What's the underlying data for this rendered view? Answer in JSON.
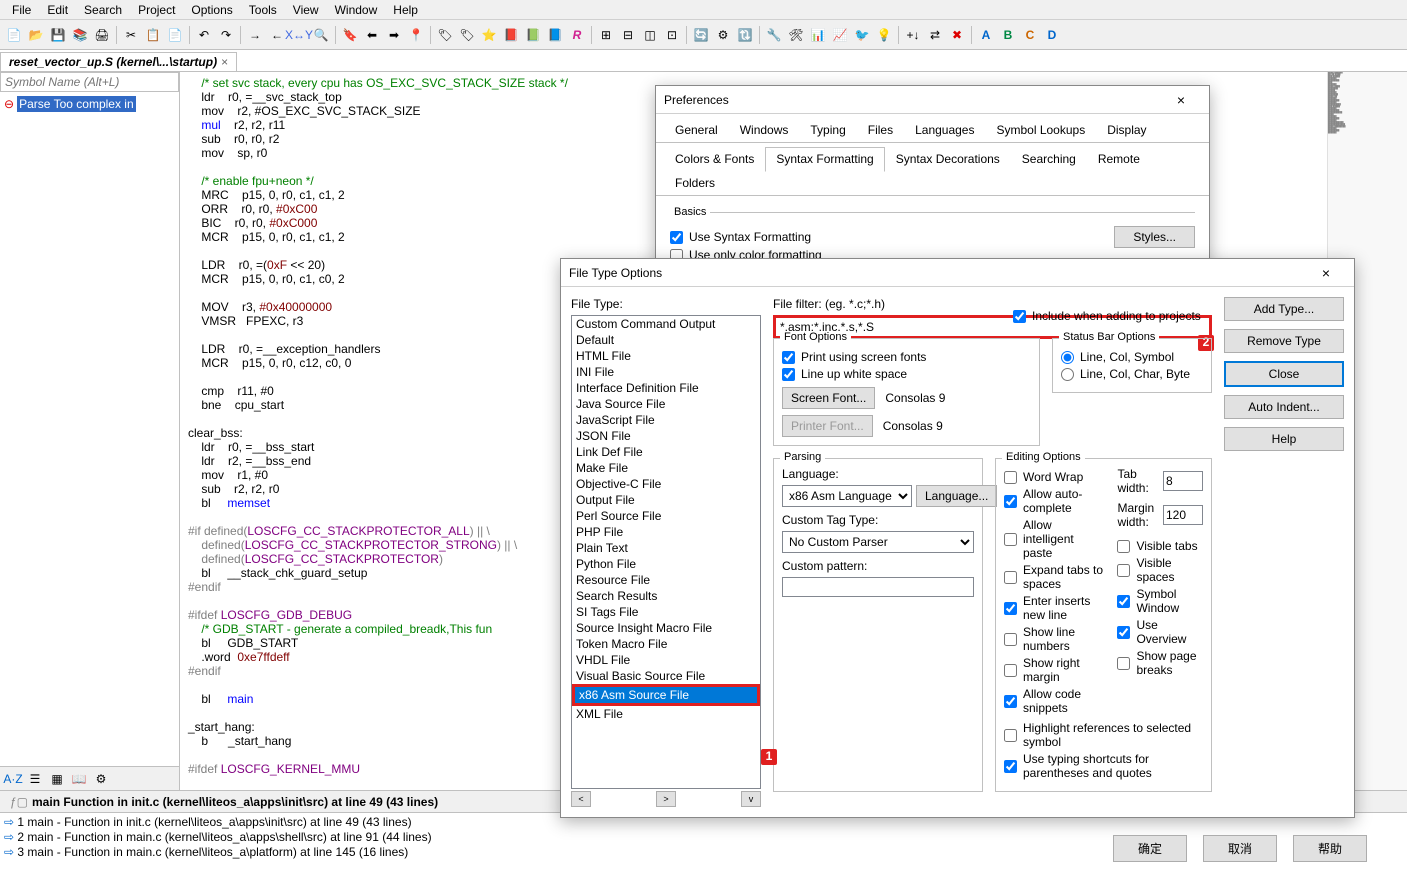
{
  "menu": [
    "File",
    "Edit",
    "Search",
    "Project",
    "Options",
    "Tools",
    "View",
    "Window",
    "Help"
  ],
  "openTab": {
    "label": "reset_vector_up.S (kernel\\...\\startup)"
  },
  "sidePanel": {
    "placeholder": "Symbol Name (Alt+L)",
    "parseErr": "Parse Too complex in"
  },
  "code": {
    "lines": [
      {
        "t": "cmt",
        "s": "    /* set svc stack, every cpu has OS_EXC_SVC_STACK_SIZE stack */"
      },
      {
        "t": "plain",
        "s": "    ldr    r0, =__svc_stack_top"
      },
      {
        "t": "plain",
        "s": "    mov    r2, #OS_EXC_SVC_STACK_SIZE"
      },
      {
        "t": "kw",
        "s": "    mul    r2, r2, r11"
      },
      {
        "t": "plain",
        "s": "    sub    r0, r0, r2"
      },
      {
        "t": "plain",
        "s": "    mov    sp, r0"
      },
      {
        "t": "plain",
        "s": ""
      },
      {
        "t": "cmt",
        "s": "    /* enable fpu+neon */"
      },
      {
        "t": "plain",
        "s": "    MRC    p15, 0, r0, c1, c1, 2"
      },
      {
        "t": "num",
        "s": "    ORR    r0, r0, #0xC00"
      },
      {
        "t": "num",
        "s": "    BIC    r0, r0, #0xC000"
      },
      {
        "t": "plain",
        "s": "    MCR    p15, 0, r0, c1, c1, 2"
      },
      {
        "t": "plain",
        "s": ""
      },
      {
        "t": "num",
        "s": "    LDR    r0, =(0xF << 20)"
      },
      {
        "t": "plain",
        "s": "    MCR    p15, 0, r0, c1, c0, 2"
      },
      {
        "t": "plain",
        "s": ""
      },
      {
        "t": "num",
        "s": "    MOV    r3, #0x40000000"
      },
      {
        "t": "plain",
        "s": "    VMSR   FPEXC, r3"
      },
      {
        "t": "plain",
        "s": ""
      },
      {
        "t": "plain",
        "s": "    LDR    r0, =__exception_handlers"
      },
      {
        "t": "plain",
        "s": "    MCR    p15, 0, r0, c12, c0, 0"
      },
      {
        "t": "plain",
        "s": ""
      },
      {
        "t": "plain",
        "s": "    cmp    r11, #0"
      },
      {
        "t": "plain",
        "s": "    bne    cpu_start"
      },
      {
        "t": "plain",
        "s": ""
      },
      {
        "t": "plain",
        "s": "clear_bss:"
      },
      {
        "t": "plain",
        "s": "    ldr    r0, =__bss_start"
      },
      {
        "t": "plain",
        "s": "    ldr    r2, =__bss_end"
      },
      {
        "t": "plain",
        "s": "    mov    r1, #0"
      },
      {
        "t": "plain",
        "s": "    sub    r2, r2, r0"
      },
      {
        "t": "kw",
        "s": "    bl     memset"
      },
      {
        "t": "plain",
        "s": ""
      },
      {
        "t": "dir",
        "s": "#if defined(LOSCFG_CC_STACKPROTECTOR_ALL) || \\"
      },
      {
        "t": "dir",
        "s": "    defined(LOSCFG_CC_STACKPROTECTOR_STRONG) || \\"
      },
      {
        "t": "dir",
        "s": "    defined(LOSCFG_CC_STACKPROTECTOR)"
      },
      {
        "t": "plain",
        "s": "    bl     __stack_chk_guard_setup"
      },
      {
        "t": "dir",
        "s": "#endif"
      },
      {
        "t": "plain",
        "s": ""
      },
      {
        "t": "dir",
        "s": "#ifdef LOSCFG_GDB_DEBUG"
      },
      {
        "t": "cmt",
        "s": "    /* GDB_START - generate a compiled_breadk,This fun"
      },
      {
        "t": "plain",
        "s": "    bl     GDB_START"
      },
      {
        "t": "num",
        "s": "    .word  0xe7ffdeff"
      },
      {
        "t": "dir",
        "s": "#endif"
      },
      {
        "t": "plain",
        "s": ""
      },
      {
        "t": "kw",
        "s": "    bl     main"
      },
      {
        "t": "plain",
        "s": ""
      },
      {
        "t": "plain",
        "s": "_start_hang:"
      },
      {
        "t": "plain",
        "s": "    b      _start_hang"
      },
      {
        "t": "plain",
        "s": ""
      },
      {
        "t": "dir",
        "s": "#ifdef LOSCFG_KERNEL_MMU"
      }
    ]
  },
  "bottomPane": {
    "header": "main Function in init.c (kernel\\liteos_a\\apps\\init\\src) at line 49 (43 lines)",
    "items": [
      "1 main - Function in init.c (kernel\\liteos_a\\apps\\init\\src) at line 49 (43 lines)",
      "2 main - Function in main.c (kernel\\liteos_a\\apps\\shell\\src) at line 91 (44 lines)",
      "3 main - Function in main.c (kernel\\liteos_a\\platform) at line 145 (16 lines)"
    ]
  },
  "prefs": {
    "title": "Preferences",
    "tabs1": [
      "General",
      "Windows",
      "Typing",
      "Files",
      "Languages",
      "Symbol Lookups",
      "Display"
    ],
    "tabs2": [
      "Colors & Fonts",
      "Syntax Formatting",
      "Syntax Decorations",
      "Searching",
      "Remote",
      "Folders"
    ],
    "activeTab": "Syntax Formatting",
    "basicsLabel": "Basics",
    "c1": "Use Syntax Formatting",
    "c2": "Use only color formatting",
    "stylesBtn": "Styles..."
  },
  "fto": {
    "title": "File Type Options",
    "fileTypeLabel": "File Type:",
    "fileFilterLabel": "File filter: (eg. *.c;*.h)",
    "fileFilterValue": "*.asm;*.inc,*.s,*.S",
    "types": [
      "Custom Command Output",
      "Default",
      "HTML File",
      "INI File",
      "Interface Definition File",
      "Java Source File",
      "JavaScript File",
      "JSON File",
      "Link Def File",
      "Make File",
      "Objective-C File",
      "Output File",
      "Perl Source File",
      "PHP File",
      "Plain Text",
      "Python File",
      "Resource File",
      "Search Results",
      "SI Tags File",
      "Source Insight Macro File",
      "Token Macro File",
      "VHDL File",
      "Visual Basic Source File",
      "x86 Asm Source File",
      "XML File"
    ],
    "selectedType": "x86 Asm Source File",
    "addTypeBtn": "Add Type...",
    "removeTypeBtn": "Remove Type",
    "includeCheck": "Include when adding to projects",
    "closeBtn": "Close",
    "autoIndentBtn": "Auto Indent...",
    "helpBtn": "Help",
    "fontOptions": {
      "title": "Font Options",
      "c1": "Print using screen fonts",
      "c2": "Line up white space",
      "screenFontBtn": "Screen Font...",
      "printerFontBtn": "Printer Font...",
      "fontDisplay": "Consolas 9"
    },
    "statusBar": {
      "title": "Status Bar Options",
      "r1": "Line, Col, Symbol",
      "r2": "Line, Col, Char, Byte"
    },
    "parsing": {
      "title": "Parsing",
      "langLabel": "Language:",
      "langValue": "x86 Asm Language",
      "langBtn": "Language...",
      "customTagLabel": "Custom Tag Type:",
      "customTagValue": "No Custom Parser",
      "customPatternLabel": "Custom pattern:"
    },
    "editing": {
      "title": "Editing Options",
      "c1": "Word Wrap",
      "c2": "Allow auto-complete",
      "c3": "Allow intelligent paste",
      "c4": "Expand tabs to spaces",
      "c5": "Enter inserts new line",
      "c6": "Show line numbers",
      "c7": "Show right margin",
      "c8": "Allow code snippets",
      "c9": "Highlight references to selected symbol",
      "c10": "Use typing shortcuts for parentheses and quotes",
      "tabWidthLabel": "Tab width:",
      "tabWidthValue": "8",
      "marginWidthLabel": "Margin width:",
      "marginWidthValue": "120",
      "v1": "Visible tabs",
      "v2": "Visible spaces",
      "v3": "Symbol Window",
      "v4": "Use Overview",
      "v5": "Show page breaks"
    }
  },
  "dlgButtons": {
    "ok": "确定",
    "cancel": "取消",
    "help": "帮助"
  },
  "annotations": {
    "badge1": "1",
    "badge2": "2"
  }
}
